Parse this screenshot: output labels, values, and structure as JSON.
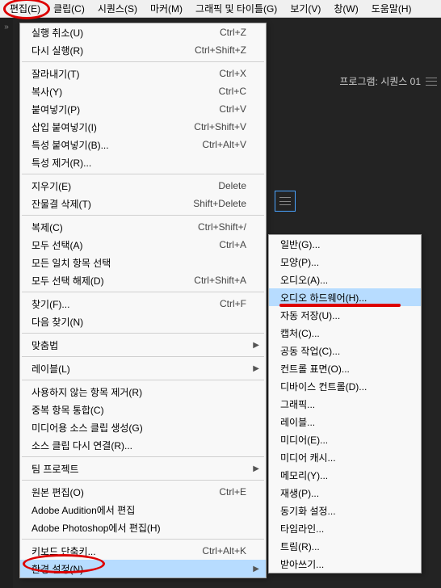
{
  "menubar": {
    "items": [
      {
        "label": "편집(E)"
      },
      {
        "label": "클립(C)"
      },
      {
        "label": "시퀀스(S)"
      },
      {
        "label": "마커(M)"
      },
      {
        "label": "그래픽 및 타이틀(G)"
      },
      {
        "label": "보기(V)"
      },
      {
        "label": "창(W)"
      },
      {
        "label": "도움말(H)"
      }
    ]
  },
  "program_panel": {
    "label": "프로그램: 시퀀스 01"
  },
  "edit_menu": {
    "groups": [
      [
        {
          "label": "실행 취소(U)",
          "shortcut": "Ctrl+Z"
        },
        {
          "label": "다시 실행(R)",
          "shortcut": "Ctrl+Shift+Z"
        }
      ],
      [
        {
          "label": "잘라내기(T)",
          "shortcut": "Ctrl+X"
        },
        {
          "label": "복사(Y)",
          "shortcut": "Ctrl+C"
        },
        {
          "label": "붙여넣기(P)",
          "shortcut": "Ctrl+V"
        },
        {
          "label": "삽입 붙여넣기(I)",
          "shortcut": "Ctrl+Shift+V"
        },
        {
          "label": "특성 붙여넣기(B)...",
          "shortcut": "Ctrl+Alt+V"
        },
        {
          "label": "특성 제거(R)...",
          "shortcut": ""
        }
      ],
      [
        {
          "label": "지우기(E)",
          "shortcut": "Delete"
        },
        {
          "label": "잔물결 삭제(T)",
          "shortcut": "Shift+Delete"
        }
      ],
      [
        {
          "label": "복제(C)",
          "shortcut": "Ctrl+Shift+/"
        },
        {
          "label": "모두 선택(A)",
          "shortcut": "Ctrl+A"
        },
        {
          "label": "모든 일치 항목 선택",
          "shortcut": ""
        },
        {
          "label": "모두 선택 해제(D)",
          "shortcut": "Ctrl+Shift+A"
        }
      ],
      [
        {
          "label": "찾기(F)...",
          "shortcut": "Ctrl+F"
        },
        {
          "label": "다음 찾기(N)",
          "shortcut": ""
        }
      ],
      [
        {
          "label": "맞춤법",
          "submenu": true
        }
      ],
      [
        {
          "label": "레이블(L)",
          "submenu": true
        }
      ],
      [
        {
          "label": "사용하지 않는 항목 제거(R)",
          "shortcut": ""
        },
        {
          "label": "중복 항목 통합(C)",
          "shortcut": ""
        },
        {
          "label": "미디어용 소스 클립 생성(G)",
          "shortcut": ""
        },
        {
          "label": "소스 클립 다시 연결(R)...",
          "shortcut": ""
        }
      ],
      [
        {
          "label": "팀 프로젝트",
          "submenu": true
        }
      ],
      [
        {
          "label": "원본 편집(O)",
          "shortcut": "Ctrl+E"
        },
        {
          "label": "Adobe Audition에서 편집",
          "shortcut": ""
        },
        {
          "label": "Adobe Photoshop에서 편집(H)",
          "shortcut": ""
        }
      ],
      [
        {
          "label": "키보드 단축키...",
          "shortcut": "Ctrl+Alt+K"
        },
        {
          "label": "환경 설정(N)",
          "submenu": true,
          "highlighted": true
        }
      ]
    ]
  },
  "preferences_submenu": {
    "items": [
      {
        "label": "일반(G)..."
      },
      {
        "label": "모양(P)..."
      },
      {
        "label": "오디오(A)..."
      },
      {
        "label": "오디오 하드웨어(H)...",
        "highlighted": true
      },
      {
        "label": "자동 저장(U)..."
      },
      {
        "label": "캡처(C)..."
      },
      {
        "label": "공동 작업(C)..."
      },
      {
        "label": "컨트롤 표면(O)..."
      },
      {
        "label": "디바이스 컨트롤(D)..."
      },
      {
        "label": "그래픽..."
      },
      {
        "label": "레이블..."
      },
      {
        "label": "미디어(E)..."
      },
      {
        "label": "미디어 캐시..."
      },
      {
        "label": "메모리(Y)..."
      },
      {
        "label": "재생(P)..."
      },
      {
        "label": "동기화 설정..."
      },
      {
        "label": "타임라인..."
      },
      {
        "label": "트림(R)..."
      },
      {
        "label": "받아쓰기..."
      }
    ]
  }
}
